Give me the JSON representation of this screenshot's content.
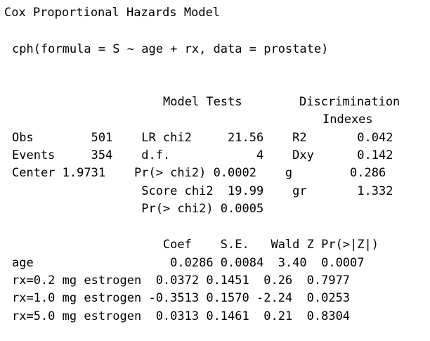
{
  "title": "Cox Proportional Hazards Model",
  "call": "cph(formula = S ~ age + rx, data = prostate)",
  "headers": {
    "model_tests": "Model Tests",
    "discrimination_line1": "Discrimination",
    "discrimination_line2": "Indexes"
  },
  "summary_rows": [
    "Obs        501    LR chi2     21.56    R2       0.042",
    "Events     354    d.f.            4    Dxy      0.142",
    "Center 1.9731    Pr(> chi2) 0.0002    g        0.286",
    "                  Score chi2  19.99    gr       1.332",
    "                  Pr(> chi2) 0.0005"
  ],
  "coef_header": "                     Coef    S.E.   Wald Z Pr(>|Z|)",
  "coef_rows": [
    "age                   0.0286 0.0084  3.40  0.0007",
    "rx=0.2 mg estrogen  0.0372 0.1451  0.26  0.7977",
    "rx=1.0 mg estrogen -0.3513 0.1570 -2.24  0.0253",
    "rx=5.0 mg estrogen  0.0313 0.1461  0.21  0.8304"
  ]
}
